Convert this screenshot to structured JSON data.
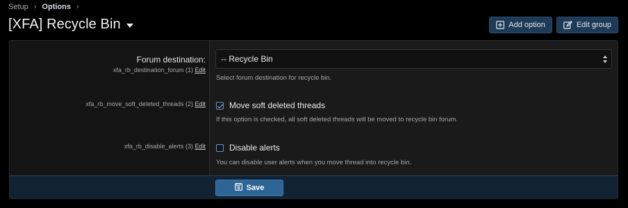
{
  "breadcrumb": {
    "items": [
      "Setup",
      "Options"
    ],
    "separator": "›"
  },
  "header": {
    "title": "[XFA] Recycle Bin",
    "add_option_label": "Add option",
    "edit_group_label": "Edit group"
  },
  "options": [
    {
      "label": "Forum destination:",
      "key": "xfa_rb_destination_forum (1)",
      "edit": "Edit",
      "select_value": "-- Recycle Bin",
      "hint": "Select forum destination for recycle bin."
    },
    {
      "key": "xfa_rb_move_soft_deleted_threads (2)",
      "edit": "Edit",
      "checkbox_label": "Move soft deleted threads",
      "checked": true,
      "hint": "If this option is checked, all soft deleted threads will be moved to recycle bin forum."
    },
    {
      "key": "xfa_rb_disable_alerts (3)",
      "edit": "Edit",
      "checkbox_label": "Disable alerts",
      "checked": false,
      "hint": "You can disable user alerts when you move thread into recycle bin."
    }
  ],
  "footer": {
    "save_label": "Save"
  },
  "colors": {
    "button_bg": "#1d3a56",
    "save_bg": "#2f6595",
    "footer_bg": "#112233"
  }
}
